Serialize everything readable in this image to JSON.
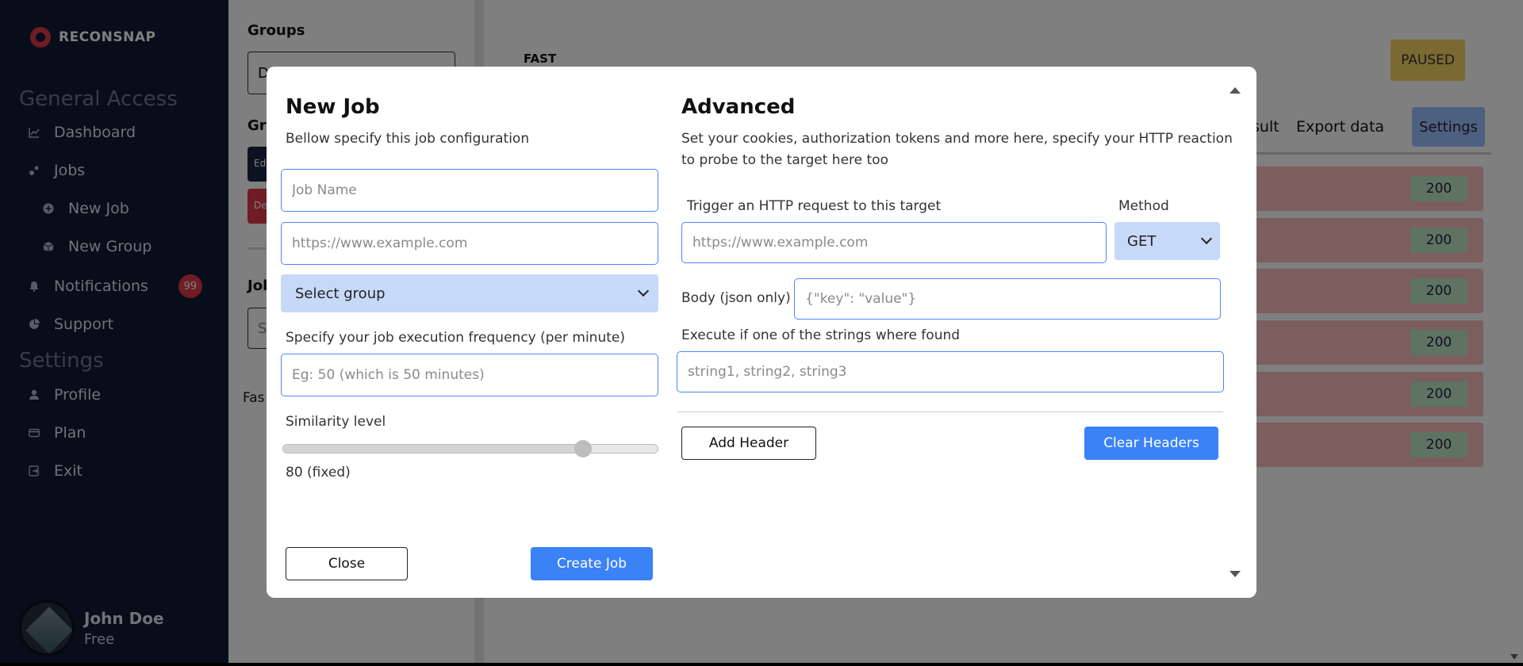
{
  "brand": {
    "name": "RECONSNAP"
  },
  "sidebar": {
    "sections": [
      {
        "title": "General Access"
      },
      {
        "title": "Settings"
      }
    ],
    "items": [
      {
        "label": "Dashboard",
        "icon": "chart-icon"
      },
      {
        "label": "Jobs",
        "icon": "gears-icon"
      },
      {
        "label": "New Job",
        "icon": "plus-circle-icon"
      },
      {
        "label": "New Group",
        "icon": "cube-icon"
      },
      {
        "label": "Notifications",
        "icon": "bell-icon",
        "badge": "99"
      },
      {
        "label": "Support",
        "icon": "pie-icon"
      },
      {
        "label": "Profile",
        "icon": "user-icon"
      },
      {
        "label": "Plan",
        "icon": "card-icon"
      },
      {
        "label": "Exit",
        "icon": "exit-icon"
      }
    ],
    "user": {
      "name": "John Doe",
      "plan": "Free"
    }
  },
  "background": {
    "groups_title": "Groups",
    "group_input_value": "D",
    "groups_sub_title": "Gr",
    "btn_edit": "Ed",
    "btn_delete": "De",
    "jobs_title": "Job",
    "job_search_value": "S",
    "fast_left": "Fas",
    "fast_label": "FAST",
    "status": "PAUSED",
    "tabs": [
      "sult",
      "Export data",
      "Settings"
    ],
    "rows": [
      "200",
      "200",
      "200",
      "200",
      "200",
      "200"
    ]
  },
  "modal": {
    "left": {
      "title": "New Job",
      "subtitle": "Bellow specify this job configuration",
      "job_name_placeholder": "Job Name",
      "url_placeholder": "https://www.example.com",
      "group_select": "Select group",
      "frequency_label": "Specify your job execution frequency (per minute)",
      "frequency_placeholder": "Eg: 50 (which is 50 minutes)",
      "similarity_label": "Similarity level",
      "similarity_value": 80,
      "similarity_text": "80 (fixed)",
      "close_label": "Close",
      "create_label": "Create Job"
    },
    "right": {
      "title": "Advanced",
      "subtitle": "Set your cookies, authorization tokens and more here, specify your HTTP reaction to probe to the target here too",
      "trigger_label": "Trigger an HTTP request to this target",
      "trigger_placeholder": "https://www.example.com",
      "method_label": "Method",
      "method_value": "GET",
      "body_label": "Body (json only)",
      "body_placeholder": "{\"key\": \"value\"}",
      "execute_label": "Execute if one of the strings where found",
      "execute_placeholder": "string1, string2, string3",
      "add_header_label": "Add Header",
      "clear_headers_label": "Clear Headers"
    }
  }
}
